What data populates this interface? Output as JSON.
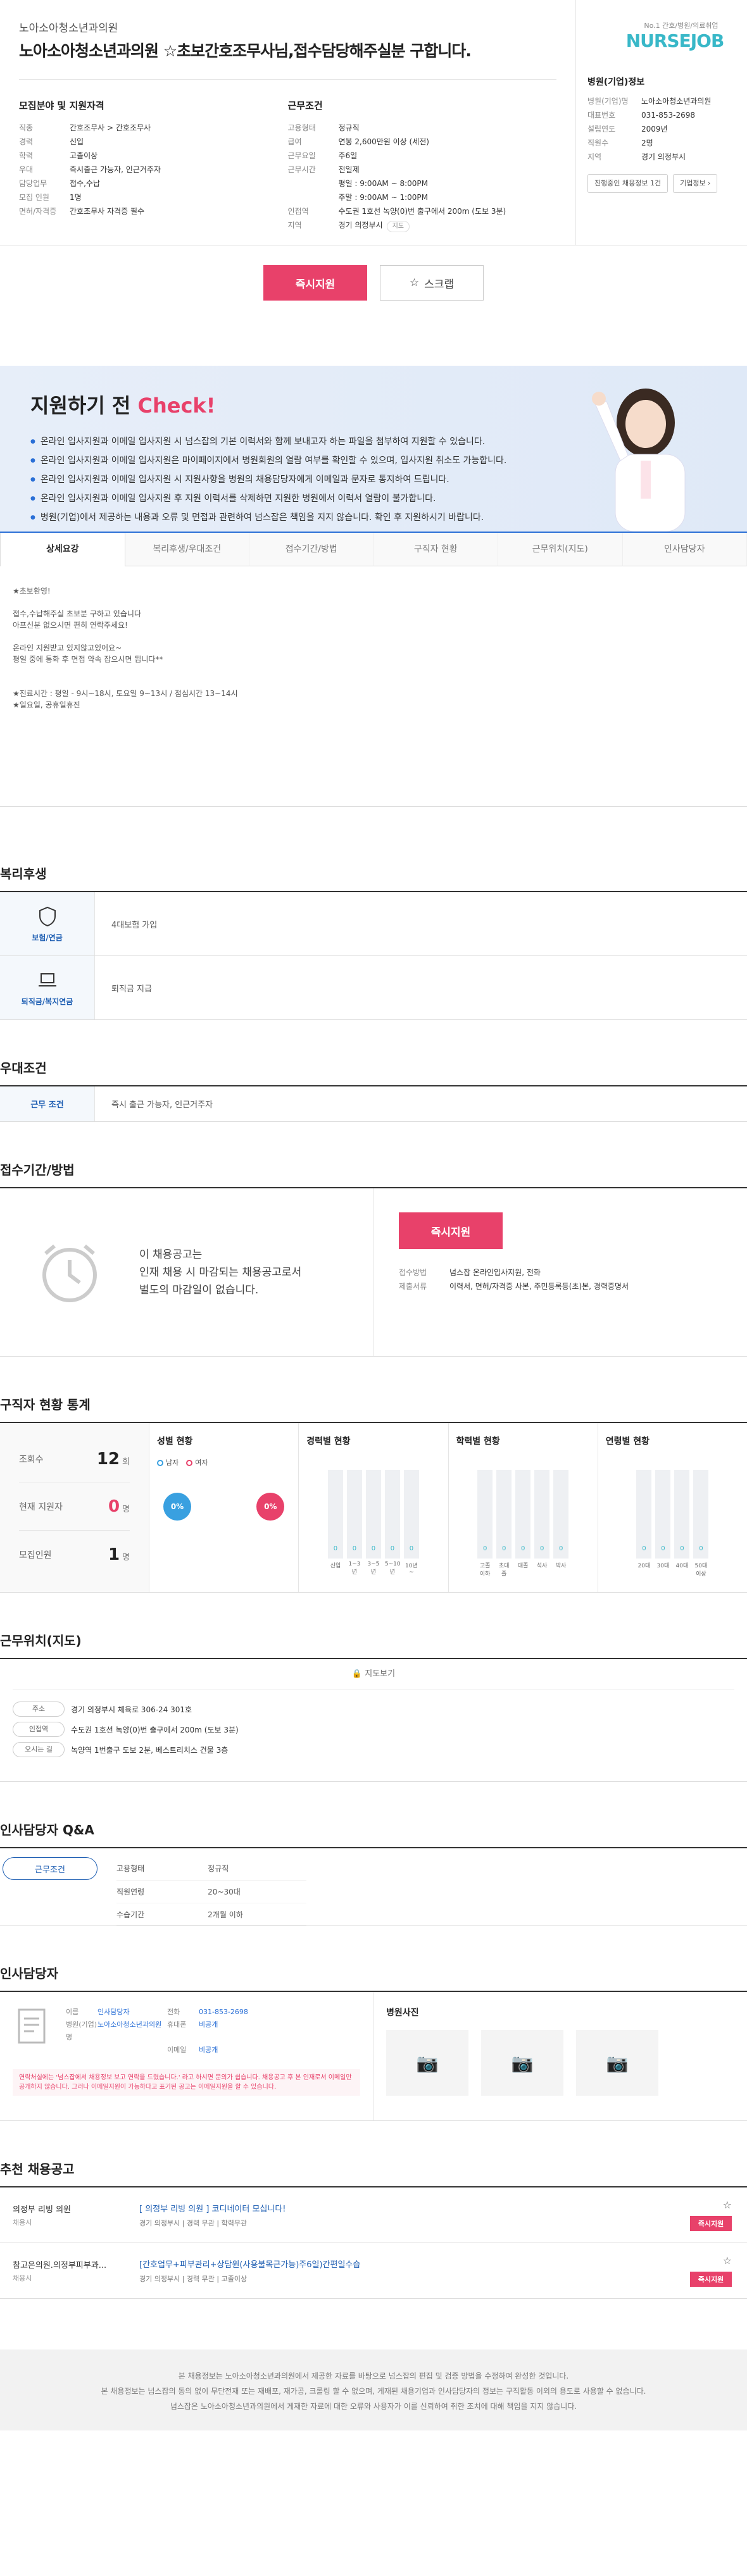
{
  "header": {
    "hospital": "노아소아청소년과의원",
    "title": "노아소아청소년과의원 ☆초보간호조무사님,접수담당해주실분 구합니다."
  },
  "req": {
    "heading": "모집분야 및 지원자격",
    "rows": [
      {
        "k": "직종",
        "v": "간호조무사 > 간호조무사"
      },
      {
        "k": "경력",
        "v": "신입"
      },
      {
        "k": "학력",
        "v": "고졸이상"
      },
      {
        "k": "우대",
        "v": "즉시출근 가능자, 인근거주자"
      },
      {
        "k": "담당업무",
        "v": "접수,수납"
      },
      {
        "k": "모집 인원",
        "v": "1명"
      },
      {
        "k": "면허/자격증",
        "v": "간호조무사 자격증 필수"
      }
    ]
  },
  "cond": {
    "heading": "근무조건",
    "rows": [
      {
        "k": "고용형태",
        "v": "정규직"
      },
      {
        "k": "급여",
        "v": "연봉 2,600만원 이상 (세전)"
      },
      {
        "k": "근무요일",
        "v": "주6일"
      },
      {
        "k": "근무시간",
        "v": "전일제"
      },
      {
        "k": "",
        "v": "평일 : 9:00AM ~ 8:00PM"
      },
      {
        "k": "",
        "v": "주말 : 9:00AM ~ 1:00PM"
      },
      {
        "k": "인접역",
        "v": "수도권 1호선 녹양(0)번 출구에서 200m (도보 3분)"
      },
      {
        "k": "지역",
        "v": "경기 의정부시"
      }
    ],
    "map_btn": "지도"
  },
  "side": {
    "logo_sub": "No.1 간호/병원/의료취업",
    "logo": "NURSEJOB",
    "heading": "병원(기업)정보",
    "rows": [
      {
        "k": "병원(기업)명",
        "v": "노아소아청소년과의원"
      },
      {
        "k": "대표번호",
        "v": "031-853-2698"
      },
      {
        "k": "설립연도",
        "v": "2009년"
      },
      {
        "k": "직원수",
        "v": "2명"
      },
      {
        "k": "지역",
        "v": "경기 의정부시"
      }
    ],
    "btn1": "진행중인 채용정보 1건",
    "btn2": "기업정보 ›"
  },
  "actions": {
    "apply": "즉시지원",
    "scrap": "스크랩"
  },
  "check": {
    "title_pre": "지원하기 전 ",
    "title_em": "Check!",
    "items": [
      "온라인 입사지원과 이메일 입사지원 시 넘스잡의 기본 이력서와 함께 보내고자 하는 파일을 첨부하여 지원할 수 있습니다.",
      "온라인 입사지원과 이메일 입사지원은 마이페이지에서 병원회원의 열람 여부를 확인할 수 있으며, 입사지원 취소도 가능합니다.",
      "온라인 입사지원과 이메일 입사지원 시 지원사항을 병원의 채용담당자에게 이메일과 문자로 통지하여 드립니다.",
      "온라인 입사지원과 이메일 입사지원 후 지원 이력서를 삭제하면 지원한 병원에서 이력서 열람이 불가합니다.",
      "병원(기업)에서 제공하는 내용과 오류 및 면접과 관련하여 넘스잡은 책임을 지지 않습니다. 확인 후 지원하시기 바랍니다."
    ]
  },
  "tabs": [
    "상세요강",
    "복리후생/우대조건",
    "접수기간/방법",
    "구직자 현황",
    "근무위치(지도)",
    "인사담당자"
  ],
  "detail": "★초보환영!\n\n접수,수납해주실 초보분 구하고 있습니다\n아프신분 없으시면 편히 연락주세요!\n\n온라인 지원받고 있지않고있어요~\n평일 중에 통화 후 면접 약속 잡으시면 됩니다**\n\n\n★진료시간 : 평일 - 9시~18시, 토요일 9~13시 / 점심시간 13~14시\n★일요일, 공휴일휴진",
  "benefits": {
    "heading": "복리후생",
    "items": [
      {
        "label": "보험/연금",
        "text": "4대보험 가입"
      },
      {
        "label": "퇴직금/복지연금",
        "text": "퇴직금 지급"
      }
    ]
  },
  "pref": {
    "heading": "우대조건",
    "label": "근무 조건",
    "text": "즉시 출근 가능자, 인근거주자"
  },
  "receipt": {
    "heading": "접수기간/방법",
    "msg": "이 채용공고는\n인재 채용 시 마감되는 채용공고로서\n별도의 마감일이 없습니다.",
    "apply": "즉시지원",
    "rows": [
      {
        "k": "접수방법",
        "v": "넘스잡 온라인입사지원, 전화"
      },
      {
        "k": "제출서류",
        "v": "이력서, 면허/자격증 사본, 주민등록등(초)본, 경력증명서"
      }
    ]
  },
  "stats": {
    "heading": "구직자 현황 통계",
    "summary": [
      {
        "k": "조회수",
        "v": "12",
        "u": "회"
      },
      {
        "k": "현재 지원자",
        "v": "0",
        "u": "명"
      },
      {
        "k": "모집인원",
        "v": "1",
        "u": "명"
      }
    ],
    "gender": {
      "title": "성별 현황",
      "male": "남자",
      "female": "여자",
      "male_pct": "0%",
      "female_pct": "0%"
    },
    "career": {
      "title": "경력별 현황",
      "labels": [
        "신입",
        "1~3년",
        "3~5년",
        "5~10년",
        "10년~"
      ],
      "values": [
        0,
        0,
        0,
        0,
        0
      ]
    },
    "edu": {
      "title": "학력별 현황",
      "labels": [
        "고졸이하",
        "초대졸",
        "대졸",
        "석사",
        "박사"
      ],
      "values": [
        0,
        0,
        0,
        0,
        0
      ]
    },
    "age": {
      "title": "연령별 현황",
      "labels": [
        "20대",
        "30대",
        "40대",
        "50대이상"
      ],
      "values": [
        0,
        0,
        0,
        0
      ]
    }
  },
  "location": {
    "heading": "근무위치(지도)",
    "map_tab": "지도보기",
    "rows": [
      {
        "k": "주소",
        "v": "경기 의정부시 체육로 306-24 301호"
      },
      {
        "k": "인접역",
        "v": "수도권 1호선 녹양(0)번 출구에서 200m (도보 3분)"
      },
      {
        "k": "오시는 길",
        "v": "녹양역 1번출구 도보 2분, 베스트리치스 건물 3층"
      }
    ]
  },
  "qa": {
    "heading": "인사담당자 Q&A",
    "pill": "근무조건",
    "rows": [
      {
        "k": "고용형태",
        "v": "정규직"
      },
      {
        "k": "직원연령",
        "v": "20~30대"
      },
      {
        "k": "수습기간",
        "v": "2개월 이하"
      }
    ]
  },
  "manager": {
    "heading": "인사담당자",
    "grid": [
      {
        "k": "이름",
        "v": "인사담당자"
      },
      {
        "k": "전화",
        "v": "031-853-2698"
      },
      {
        "k": "병원(기업)명",
        "v": "노아소아청소년과의원"
      },
      {
        "k": "휴대폰",
        "v": "비공개"
      },
      {
        "k": "",
        "v": ""
      },
      {
        "k": "이메일",
        "v": "비공개"
      }
    ],
    "note": "연락처실에는 '넘스잡에서 채용정보 보고 연락을 드렸습니다.' 라고 하시면 문의가 쉽습니다. 채용공고 후 본 인재로서 이메일만 공개하지 않습니다. 그러나 이메일지원이 가능하다고 표기된 공고는 이메일지원을 할 수 있습니다.",
    "photo_title": "병원사진"
  },
  "recommend": {
    "heading": "추천 채용공고",
    "items": [
      {
        "company": "의정부 리빙 의원",
        "sub": "채용시",
        "title": "[ 의정부 리빙 의원 ] 코디네이터 모십니다!",
        "meta": "경기 의정부시 | 경력 무관 | 학력무관"
      },
      {
        "company": "참고은의원.의정부피부과...",
        "sub": "채용시",
        "title": "[간호업무+피부관리+상담원(사용불목근가능)주6일)간편일수습",
        "meta": "경기 의정부시 | 경력 무관 | 고졸이상"
      }
    ],
    "apply": "즉시지원"
  },
  "footer": [
    "본 채용정보는 노아소아청소년과의원에서 제공한 자료를 바탕으로 넘스잡의 편집 및 검증 방법을 수정하여 완성한 것입니다.",
    "본 채용정보는 넘스잡의 동의 없이 무단전재 또는 재배포, 재가공, 크롤링 할 수 없으며, 게재된 채용기업과 인사담당자의 정보는 구직활동 이외의 용도로 사용할 수 없습니다.",
    "넘스잡은 노아소아청소년과의원에서 게재한 자료에 대한 오류와 사용자가 이를 신뢰하여 취한 조치에 대해 책임을 지지 않습니다."
  ]
}
